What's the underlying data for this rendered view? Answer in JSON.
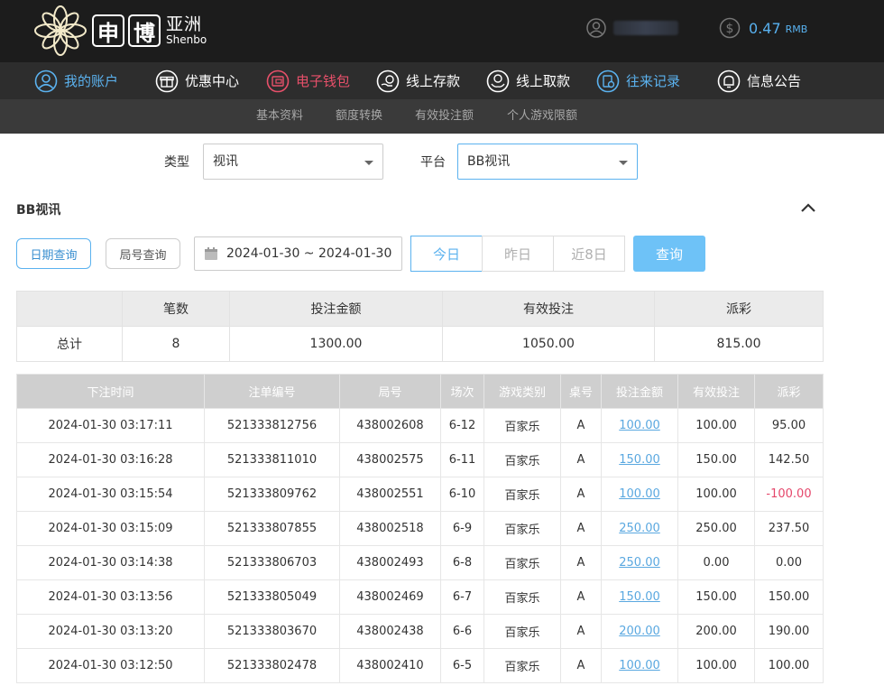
{
  "brand": {
    "logo_char1": "申",
    "logo_char2": "博",
    "name_cn": "亚洲",
    "name_en": "Shenbo"
  },
  "account": {
    "balance": "0.47",
    "currency": "RMB"
  },
  "nav": [
    {
      "label": "我的账户",
      "icon": "user-circle-icon"
    },
    {
      "label": "优惠中心",
      "icon": "gift-icon"
    },
    {
      "label": "电子钱包",
      "icon": "wallet-icon"
    },
    {
      "label": "线上存款",
      "icon": "deposit-icon"
    },
    {
      "label": "线上取款",
      "icon": "withdraw-icon"
    },
    {
      "label": "往来记录",
      "icon": "records-icon"
    },
    {
      "label": "信息公告",
      "icon": "bell-icon"
    }
  ],
  "subnav": [
    "基本资料",
    "额度转换",
    "有效投注额",
    "个人游戏限额"
  ],
  "filters": {
    "type_label": "类型",
    "type_value": "视讯",
    "platform_label": "平台",
    "platform_value": "BB视讯"
  },
  "section_title": "BB视讯",
  "query": {
    "date_query": "日期查询",
    "round_query": "局号查询",
    "date_range": "2024-01-30 ~ 2024-01-30",
    "today": "今日",
    "yesterday": "昨日",
    "last8": "近8日",
    "submit": "查询"
  },
  "summary": {
    "headers": [
      "",
      "笔数",
      "投注金额",
      "有效投注",
      "派彩"
    ],
    "row": {
      "label": "总计",
      "count": "8",
      "bet": "1300.00",
      "valid": "1050.00",
      "payout": "815.00"
    }
  },
  "records": {
    "headers": [
      "下注时间",
      "注单编号",
      "局号",
      "场次",
      "游戏类别",
      "桌号",
      "投注金额",
      "有效投注",
      "派彩"
    ],
    "rows": [
      {
        "time": "2024-01-30 03:17:11",
        "order": "521333812756",
        "round": "438002608",
        "session": "6-12",
        "game": "百家乐",
        "table": "A",
        "bet": "100.00",
        "valid": "100.00",
        "payout": "95.00"
      },
      {
        "time": "2024-01-30 03:16:28",
        "order": "521333811010",
        "round": "438002575",
        "session": "6-11",
        "game": "百家乐",
        "table": "A",
        "bet": "150.00",
        "valid": "150.00",
        "payout": "142.50"
      },
      {
        "time": "2024-01-30 03:15:54",
        "order": "521333809762",
        "round": "438002551",
        "session": "6-10",
        "game": "百家乐",
        "table": "A",
        "bet": "100.00",
        "valid": "100.00",
        "payout": "-100.00"
      },
      {
        "time": "2024-01-30 03:15:09",
        "order": "521333807855",
        "round": "438002518",
        "session": "6-9",
        "game": "百家乐",
        "table": "A",
        "bet": "250.00",
        "valid": "250.00",
        "payout": "237.50"
      },
      {
        "time": "2024-01-30 03:14:38",
        "order": "521333806703",
        "round": "438002493",
        "session": "6-8",
        "game": "百家乐",
        "table": "A",
        "bet": "250.00",
        "valid": "0.00",
        "payout": "0.00"
      },
      {
        "time": "2024-01-30 03:13:56",
        "order": "521333805049",
        "round": "438002469",
        "session": "6-7",
        "game": "百家乐",
        "table": "A",
        "bet": "150.00",
        "valid": "150.00",
        "payout": "150.00"
      },
      {
        "time": "2024-01-30 03:13:20",
        "order": "521333803670",
        "round": "438002438",
        "session": "6-6",
        "game": "百家乐",
        "table": "A",
        "bet": "200.00",
        "valid": "200.00",
        "payout": "190.00"
      },
      {
        "time": "2024-01-30 03:12:50",
        "order": "521333802478",
        "round": "438002410",
        "session": "6-5",
        "game": "百家乐",
        "table": "A",
        "bet": "100.00",
        "valid": "100.00",
        "payout": "100.00"
      }
    ]
  },
  "colors": {
    "header_bg": "#1c1c1c",
    "nav_bg": "#2d2d2d",
    "accent_blue": "#5bb2ef",
    "accent_red": "#e8506a",
    "negative": "#e5476b"
  }
}
